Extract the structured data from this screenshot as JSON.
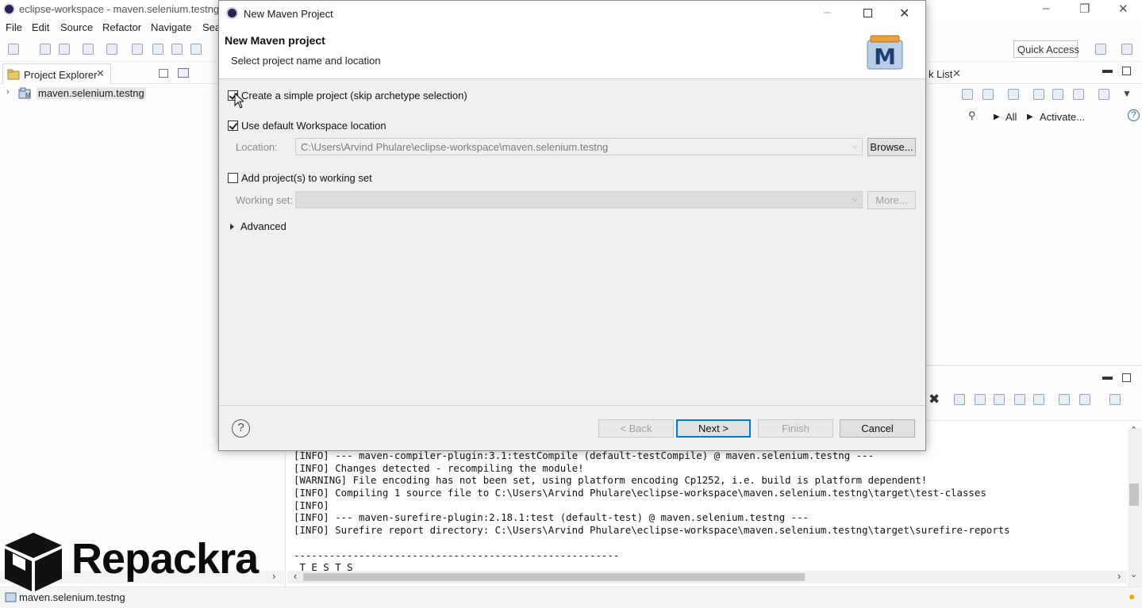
{
  "eclipse": {
    "title": "eclipse-workspace - maven.selenium.testng/",
    "menu": [
      "File",
      "Edit",
      "Source",
      "Refactor",
      "Navigate",
      "Sea"
    ],
    "quick_access": "Quick Access",
    "project_explorer": {
      "tab_label": "Project Explorer",
      "tree_item": "maven.selenium.testng"
    },
    "right_panel": {
      "tab_label": "k List",
      "link_all": "All",
      "link_activate": "Activate..."
    },
    "console": {
      "lines": [
        "[INFO] --- maven-compiler-plugin:3.1:testCompile (default-testCompile) @ maven.selenium.testng ---",
        "[INFO] Changes detected - recompiling the module!",
        "[WARNING] File encoding has not been set, using platform encoding Cp1252, i.e. build is platform dependent!",
        "[INFO] Compiling 1 source file to C:\\Users\\Arvind Phulare\\eclipse-workspace\\maven.selenium.testng\\target\\test-classes",
        "[INFO]",
        "[INFO] --- maven-surefire-plugin:2.18.1:test (default-test) @ maven.selenium.testng ---",
        "[INFO] Surefire report directory: C:\\Users\\Arvind Phulare\\eclipse-workspace\\maven.selenium.testng\\target\\surefire-reports",
        "",
        "-------------------------------------------------------",
        " T E S T S"
      ]
    },
    "status_text": "maven.selenium.testng",
    "watermark_text": "Repackra"
  },
  "dialog": {
    "title": "New Maven Project",
    "header_title": "New Maven project",
    "header_subtitle": "Select project name and location",
    "logo_letter": "M",
    "simple_project": {
      "label": "Create a simple project (skip archetype selection)",
      "checked": true
    },
    "default_workspace": {
      "label": "Use default Workspace location",
      "checked": true
    },
    "location": {
      "label": "Location:",
      "value": "C:\\Users\\Arvind Phulare\\eclipse-workspace\\maven.selenium.testng"
    },
    "browse_label": "Browse...",
    "working_set_option": {
      "label": "Add project(s) to working set",
      "checked": false
    },
    "working_set": {
      "label": "Working set:",
      "value": ""
    },
    "more_label": "More...",
    "advanced_label": "Advanced",
    "help_symbol": "?",
    "buttons": {
      "back": "< Back",
      "next": "Next >",
      "finish": "Finish",
      "cancel": "Cancel"
    }
  },
  "colors": {
    "accent": "#0078d7",
    "dialog_bg": "#f0f0f0",
    "disabled_text": "#a0a0a0"
  }
}
